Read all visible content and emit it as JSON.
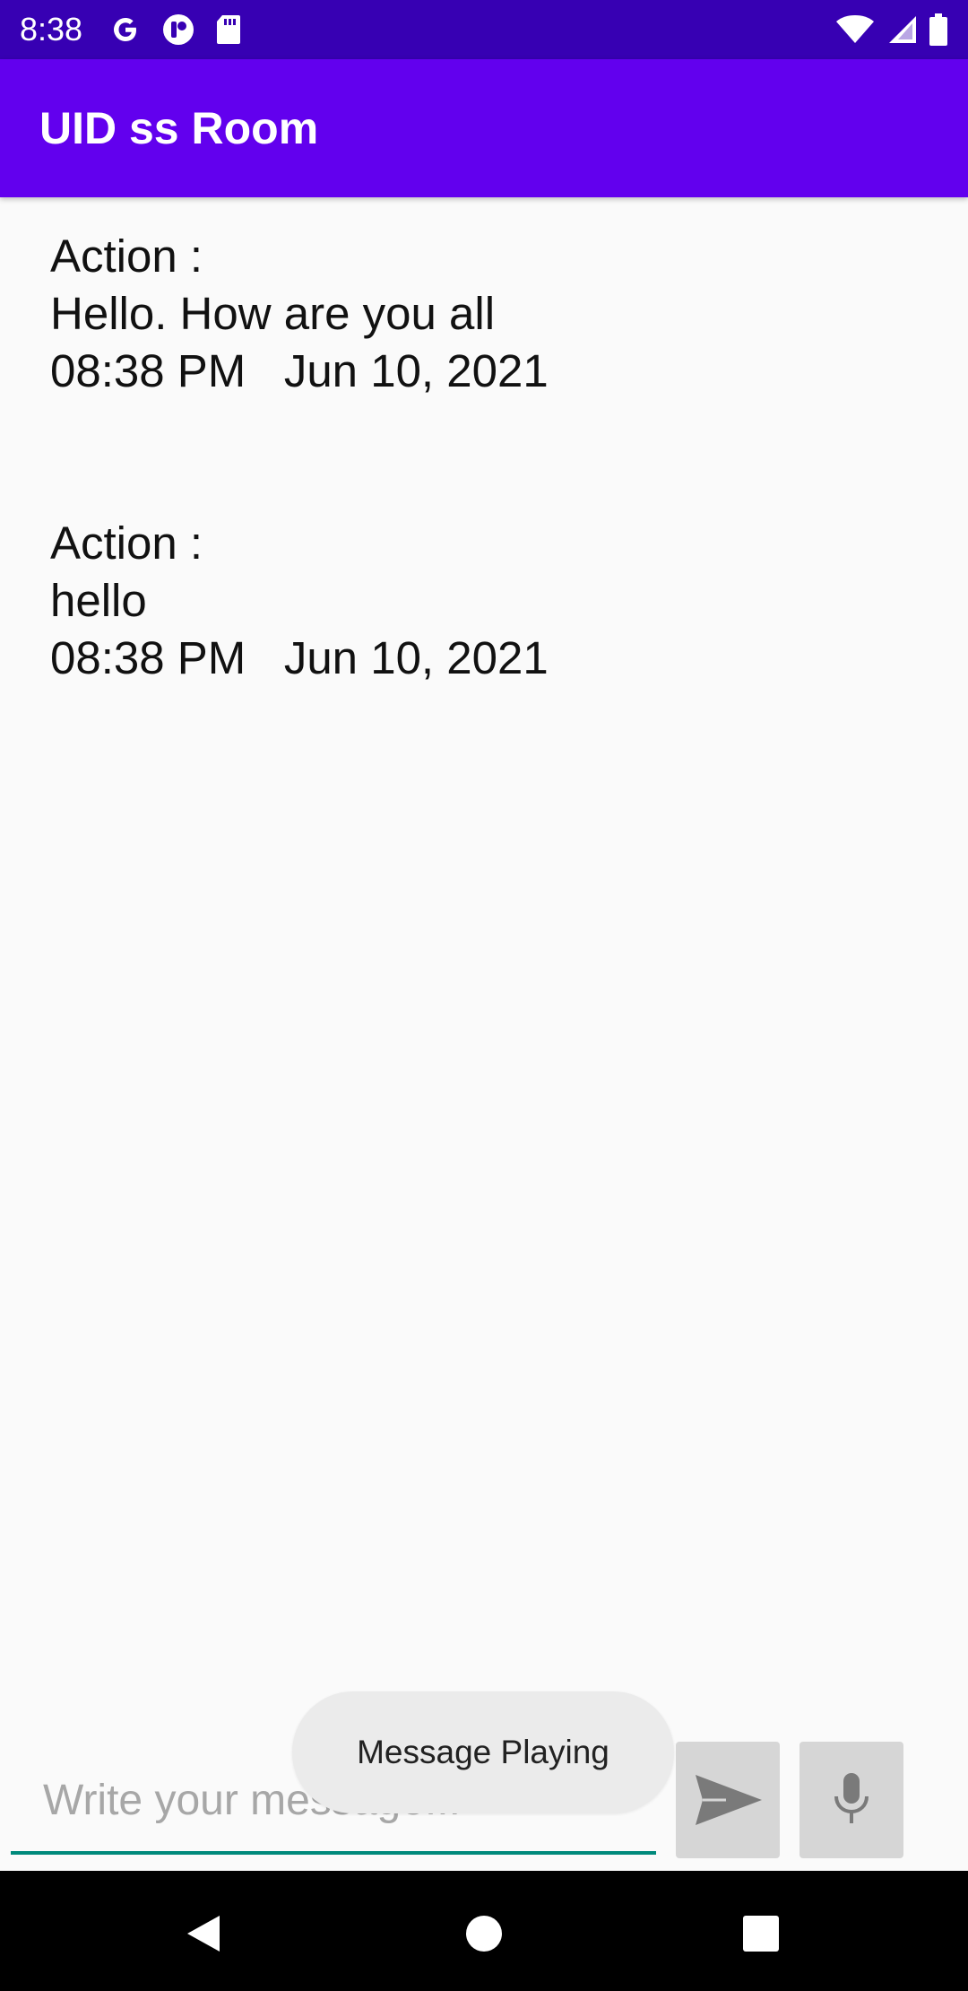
{
  "status_bar": {
    "time": "8:38",
    "icons_left": [
      "google-icon",
      "app-notification-icon",
      "sd-card-icon"
    ],
    "icons_right": [
      "wifi-icon",
      "signal-icon",
      "battery-icon"
    ]
  },
  "app_bar": {
    "title": "UID ss Room",
    "color": "#6200EE"
  },
  "messages": [
    {
      "label": "Action :",
      "text": "Hello. How are you all",
      "time": "08:38 PM",
      "date": "Jun 10, 2021"
    },
    {
      "label": "Action :",
      "text": "hello",
      "time": "08:38 PM",
      "date": "Jun 10, 2021"
    }
  ],
  "composer": {
    "value": "",
    "placeholder": "Write your message...",
    "send_icon": "send-icon",
    "mic_icon": "mic-icon",
    "accent_color": "#00897B"
  },
  "toast": {
    "text": "Message Playing"
  },
  "nav_bar": {
    "icons": [
      "back-icon",
      "home-icon",
      "recents-icon"
    ]
  }
}
